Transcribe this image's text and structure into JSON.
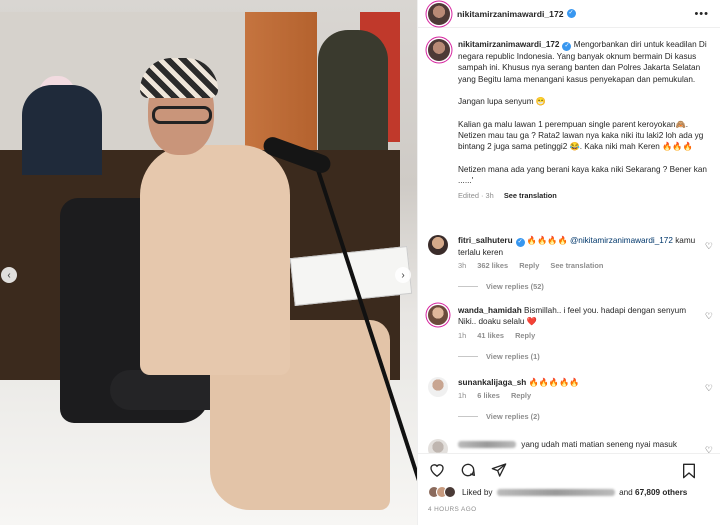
{
  "post": {
    "username": "nikitamirzanimawardi_172",
    "caption_username": "nikitamirzanimawardi_172",
    "caption_p1": "Mengorbankan diri untuk keadilan Di negara republic Indonesia. Yang banyak oknum bermain Di kasus sampah ini. Khusus nya serang banten dan Polres Jakarta Selatan yang Begitu lama menangani kasus penyekapan dan pemukulan.",
    "caption_p2": "Jangan lupa senyum 😁",
    "caption_p3": "Kalian ga malu lawan 1 perempuan single parent keroyokan🙈. Netizen mau tau ga ? Rata2 lawan nya kaka niki itu laki2 loh ada yg bintang 2 juga sama petinggi2 😂. Kaka niki mah Keren 🔥🔥🔥",
    "caption_p4": "Netizen mana ada yang berani kaya kaka niki Sekarang ? Bener kan ......'",
    "edited": "Edited · 3h",
    "see_translation": "See translation"
  },
  "comments": [
    {
      "username": "fitri_salhuteru",
      "text_pre": "🔥🔥🔥🔥",
      "mention": "@nikitamirzanimawardi_172",
      "text_post": "kamu terlalu keren",
      "time": "3h",
      "likes": "362 likes",
      "reply": "Reply",
      "translation": "See translation",
      "view_replies": "View replies (52)"
    },
    {
      "username": "wanda_hamidah",
      "text": "Bismillah.. i feel you. hadapi dengan senyum Niki.. doaku selalu ❤️",
      "time": "1h",
      "likes": "41 likes",
      "reply": "Reply",
      "view_replies": "View replies (1)"
    },
    {
      "username": "sunankalijaga_sh",
      "text": "🔥🔥🔥🔥🔥",
      "time": "1h",
      "likes": "6 likes",
      "reply": "Reply",
      "view_replies": "View replies (2)"
    },
    {
      "text": "yang udah mati matian seneng nyai masuk"
    }
  ],
  "footer": {
    "liked_by": "Liked by",
    "and": "and",
    "others": "67,809 others",
    "time_ago": "4 HOURS AGO"
  },
  "icons": {
    "heart": "heart-icon",
    "comment": "comment-icon",
    "share": "share-icon",
    "bookmark": "bookmark-icon",
    "more": "more-icon",
    "verified": "verified-badge-icon"
  },
  "colors": {
    "accent": "#3897f0",
    "link": "#00376b",
    "muted": "#8e8e8e",
    "text": "#262626"
  }
}
